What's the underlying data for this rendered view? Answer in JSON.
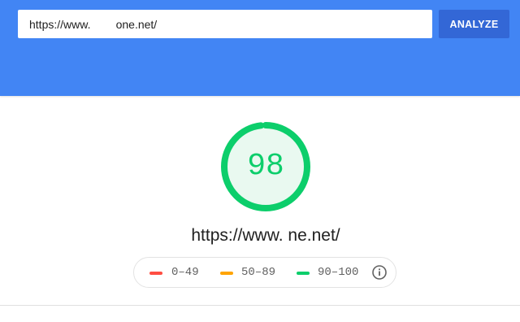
{
  "search": {
    "url_value": "https://www.        one.net/",
    "analyze_label": "ANALYZE"
  },
  "score": {
    "value": "98",
    "fraction": 0.98
  },
  "tested_url": "https://www.            ne.net/",
  "legend": {
    "fail": "0–49",
    "average": "50–89",
    "pass": "90–100",
    "info_icon": "info-icon"
  },
  "colors": {
    "header": "#4285f4",
    "analyze_button": "#3367d6",
    "pass": "#0cce6b",
    "pass_fill": "#e9f9f0",
    "average": "#ffa400",
    "fail": "#ff4e42"
  }
}
